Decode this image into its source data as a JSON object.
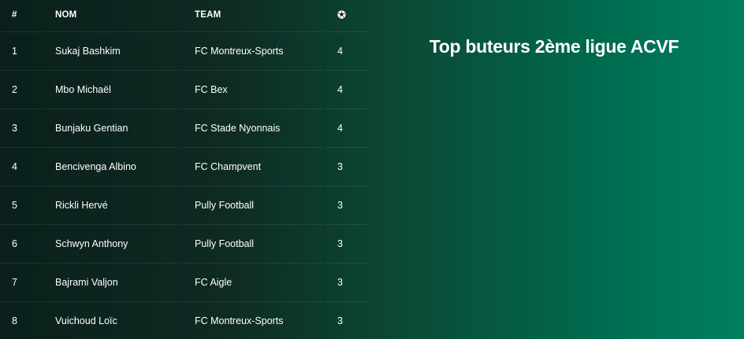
{
  "title": "Top buteurs 2ème ligue ACVF",
  "table": {
    "headers": {
      "rank": "#",
      "name": "NOM",
      "team": "TEAM",
      "goals_icon": "soccer-ball-icon"
    },
    "rows": [
      {
        "rank": "1",
        "name": "Sukaj Bashkim",
        "team": "FC Montreux-Sports",
        "goals": "4"
      },
      {
        "rank": "2",
        "name": "Mbo Michaël",
        "team": "FC Bex",
        "goals": "4"
      },
      {
        "rank": "3",
        "name": "Bunjaku Gentian",
        "team": "FC Stade Nyonnais",
        "goals": "4"
      },
      {
        "rank": "4",
        "name": "Bencivenga Albino",
        "team": "FC Champvent",
        "goals": "3"
      },
      {
        "rank": "5",
        "name": "Rickli Hervé",
        "team": "Pully Football",
        "goals": "3"
      },
      {
        "rank": "6",
        "name": "Schwyn Anthony",
        "team": "Pully Football",
        "goals": "3"
      },
      {
        "rank": "7",
        "name": "Bajrami Valjon",
        "team": "FC Aigle",
        "goals": "3"
      },
      {
        "rank": "8",
        "name": "Vuichoud Loïc",
        "team": "FC Montreux-Sports",
        "goals": "3"
      }
    ]
  },
  "colors": {
    "text": "#ffffff",
    "background_dark": "#0a1f1b",
    "background_green": "#008060"
  }
}
